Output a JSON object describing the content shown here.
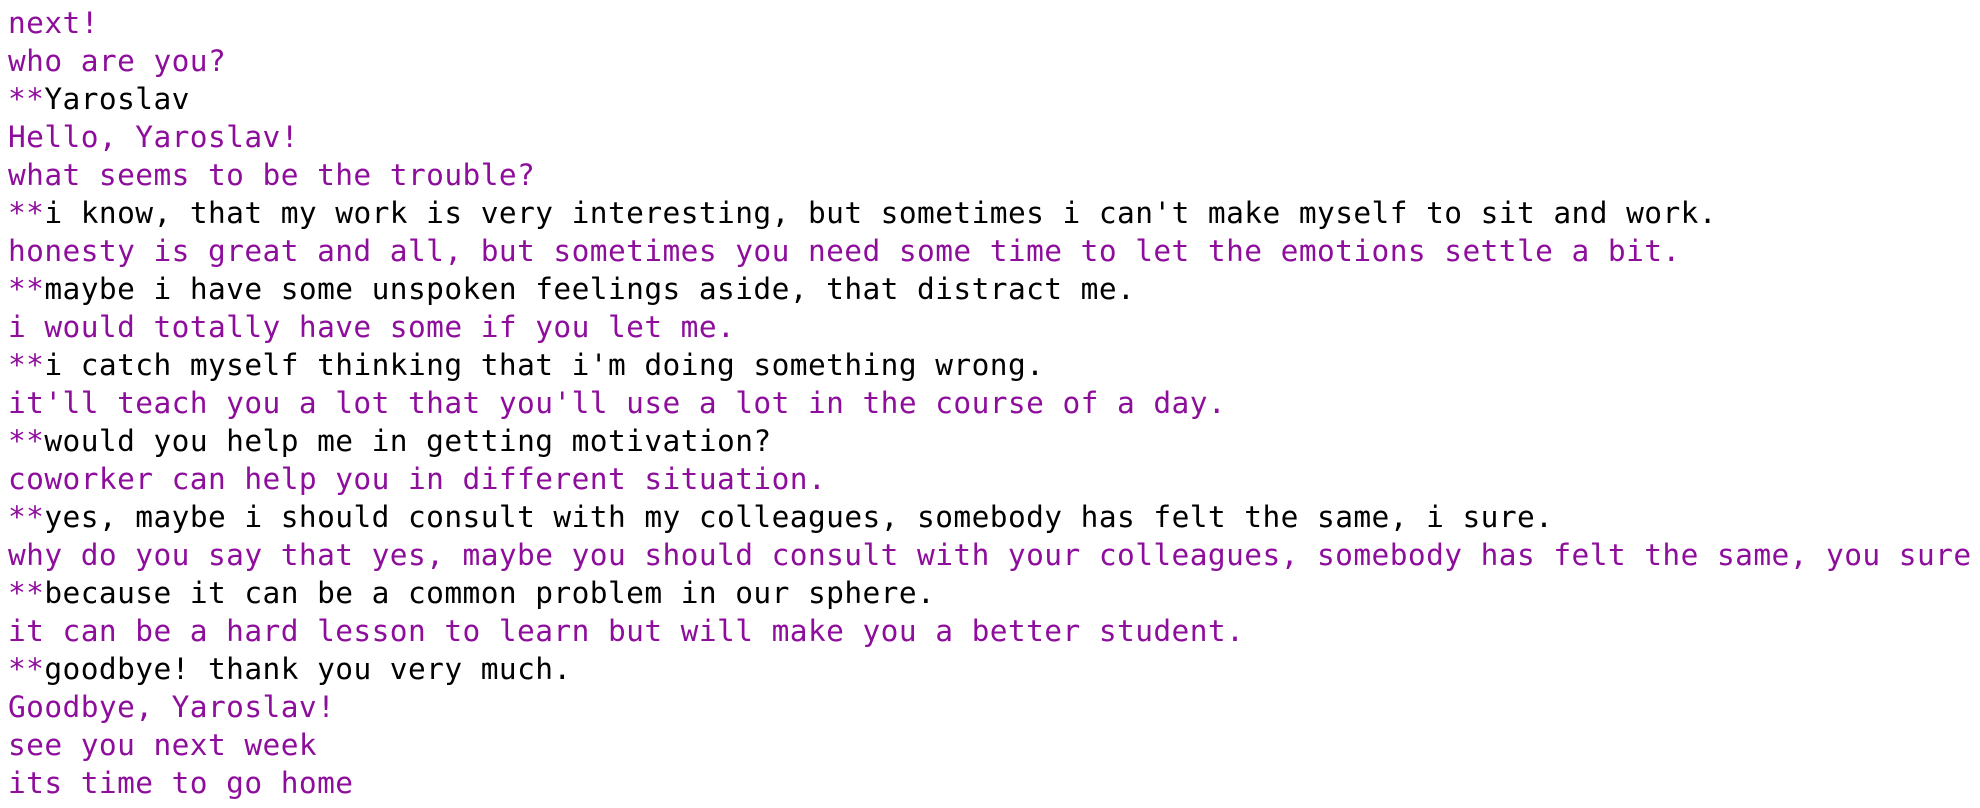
{
  "colors": {
    "bot_text": "#8e0e9c",
    "user_text": "#000000",
    "prompt_marker": "#8e0e9c",
    "background": "#ffffff"
  },
  "lines": [
    {
      "speaker": "bot",
      "text": "next!"
    },
    {
      "speaker": "bot",
      "text": "who are you?"
    },
    {
      "speaker": "user",
      "prompt": "**",
      "text": "Yaroslav"
    },
    {
      "speaker": "bot",
      "text": "Hello, Yaroslav!"
    },
    {
      "speaker": "bot",
      "text": "what seems to be the trouble?"
    },
    {
      "speaker": "user",
      "prompt": "**",
      "text": "i know, that my work is very interesting, but sometimes i can't make myself to sit and work."
    },
    {
      "speaker": "bot",
      "text": "honesty is great and all, but sometimes you need some time to let the emotions settle a bit."
    },
    {
      "speaker": "user",
      "prompt": "**",
      "text": "maybe i have some unspoken feelings aside, that distract me."
    },
    {
      "speaker": "bot",
      "text": "i would totally have some if you let me."
    },
    {
      "speaker": "user",
      "prompt": "**",
      "text": "i catch myself thinking that i'm doing something wrong."
    },
    {
      "speaker": "bot",
      "text": "it'll teach you a lot that you'll use a lot in the course of a day."
    },
    {
      "speaker": "user",
      "prompt": "**",
      "text": "would you help me in getting motivation?"
    },
    {
      "speaker": "bot",
      "text": "coworker can help you in different situation."
    },
    {
      "speaker": "user",
      "prompt": "**",
      "text": "yes, maybe i should consult with my colleagues, somebody has felt the same, i sure."
    },
    {
      "speaker": "bot",
      "text": "why do you say that yes, maybe you should consult with your colleagues, somebody has felt the same, you sure"
    },
    {
      "speaker": "user",
      "prompt": "**",
      "text": "because it can be a common problem in our sphere."
    },
    {
      "speaker": "bot",
      "text": "it can be a hard lesson to learn but will make you a better student."
    },
    {
      "speaker": "user",
      "prompt": "**",
      "text": "goodbye! thank you very much."
    },
    {
      "speaker": "bot",
      "text": "Goodbye, Yaroslav!"
    },
    {
      "speaker": "bot",
      "text": "see you next week"
    },
    {
      "speaker": "bot",
      "text": "its time to go home"
    }
  ]
}
